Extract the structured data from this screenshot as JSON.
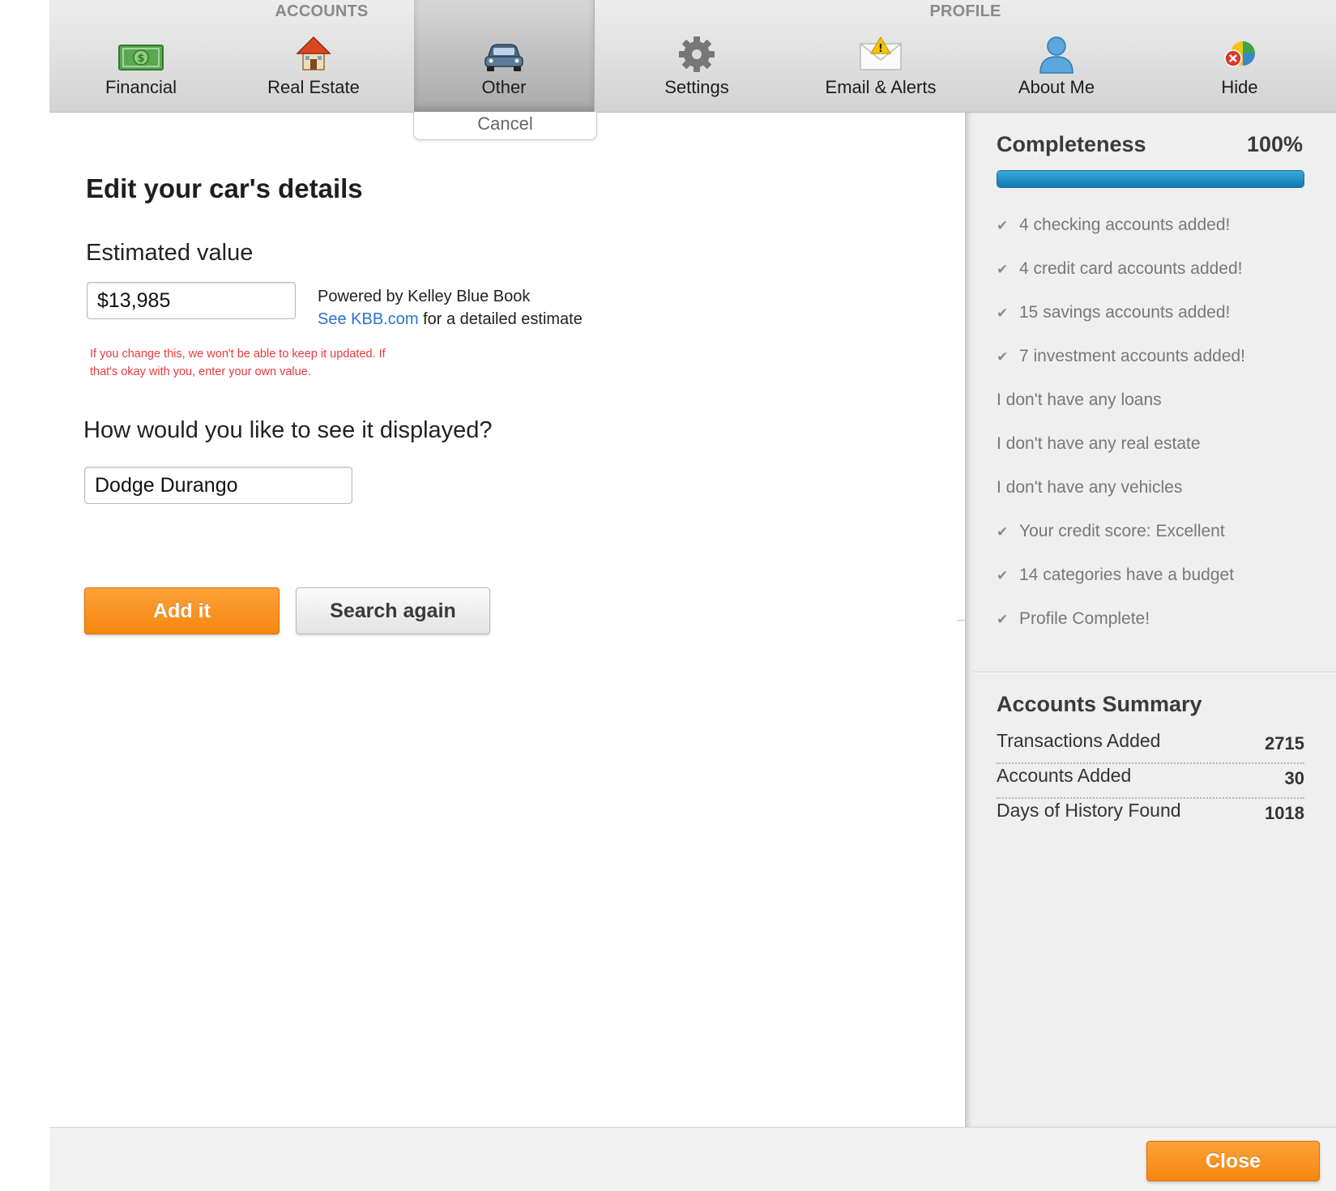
{
  "nav": {
    "accounts_label": "ACCOUNTS",
    "profile_label": "PROFILE",
    "items": [
      {
        "label": "Financial",
        "icon": "money-icon"
      },
      {
        "label": "Real Estate",
        "icon": "house-icon"
      },
      {
        "label": "Other",
        "icon": "car-icon",
        "active": true
      },
      {
        "label": "Settings",
        "icon": "gear-icon"
      },
      {
        "label": "Email & Alerts",
        "icon": "envelope-alert-icon"
      },
      {
        "label": "About Me",
        "icon": "person-icon"
      },
      {
        "label": "Hide",
        "icon": "hide-icon"
      }
    ],
    "cancel_label": "Cancel"
  },
  "form": {
    "title": "Edit your car's details",
    "estimated_value_label": "Estimated value",
    "estimated_value": "$13,985",
    "kbb_powered": "Powered by Kelley Blue Book",
    "kbb_link": "See KBB.com",
    "kbb_suffix": " for a detailed estimate",
    "warning": "If you change this, we won't be able to keep it updated. If that's okay with you, enter your own value.",
    "display_label": "How would you like to see it displayed?",
    "display_name": "Dodge Durango",
    "add_button": "Add it",
    "search_button": "Search again"
  },
  "sidebar": {
    "completeness_label": "Completeness",
    "completeness_percent": "100%",
    "completeness_value": 1.0,
    "items": [
      {
        "text": "4 checking accounts added!",
        "checked": true
      },
      {
        "text": "4 credit card accounts added!",
        "checked": true
      },
      {
        "text": "15 savings accounts added!",
        "checked": true
      },
      {
        "text": "7 investment accounts added!",
        "checked": true
      },
      {
        "text": "I don't have any loans",
        "checked": false
      },
      {
        "text": "I don't have any real estate",
        "checked": false
      },
      {
        "text": "I don't have any vehicles",
        "checked": false
      },
      {
        "text": "Your credit score: Excellent",
        "checked": true
      },
      {
        "text": "14 categories have a budget",
        "checked": true
      },
      {
        "text": "Profile Complete!",
        "checked": true
      }
    ],
    "summary_title": "Accounts Summary",
    "summary": [
      {
        "label": "Transactions Added",
        "value": "2715"
      },
      {
        "label": "Accounts Added",
        "value": "30"
      },
      {
        "label": "Days of History Found",
        "value": "1018"
      }
    ]
  },
  "footer": {
    "close_button": "Close"
  },
  "colors": {
    "accent_orange": "#f6860e",
    "progress_blue": "#0d7bb6",
    "warning_red": "#e8393d",
    "link_blue": "#2a74c9"
  }
}
